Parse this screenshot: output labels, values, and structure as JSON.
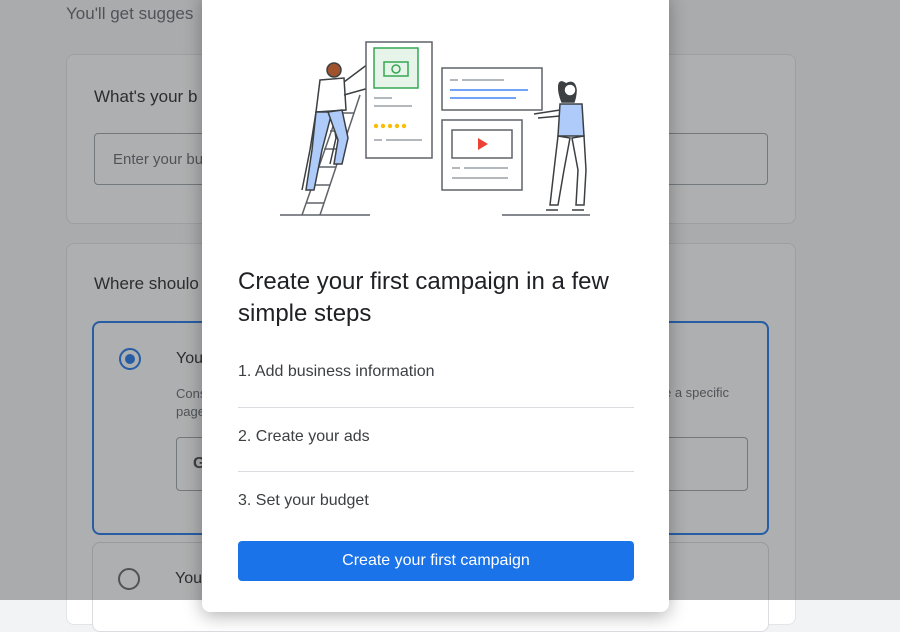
{
  "background": {
    "intro_text": "You'll get sugges",
    "budget_card": {
      "title": "What's your b",
      "input_placeholder": "Enter your bu"
    },
    "where_card": {
      "title": "Where shoulo",
      "option_1": {
        "title": "You",
        "description": "Cons",
        "description_line2": "page",
        "description_right": "e a specific",
        "url_prefix": "G",
        "selected": true
      },
      "option_2": {
        "title": "You",
        "selected": false
      }
    }
  },
  "dialog": {
    "title": "Create your first campaign in a few simple steps",
    "steps": [
      {
        "label": "1. Add business information"
      },
      {
        "label": "2. Create your ads"
      },
      {
        "label": "3. Set your budget"
      }
    ],
    "cta_label": "Create your first campaign"
  },
  "colors": {
    "accent": "#1a73e8",
    "scrim": "rgba(60,64,67,0.42)",
    "illustration_green": "#34a853",
    "illustration_red": "#ea4335",
    "illustration_yellow": "#fbbc04",
    "illustration_blue": "#4285f4"
  }
}
